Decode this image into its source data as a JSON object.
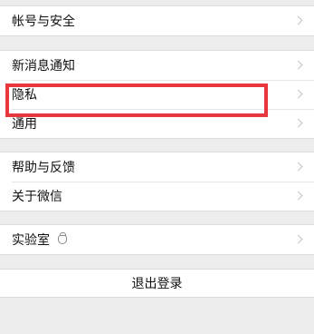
{
  "groups": {
    "account": {
      "items": [
        {
          "label": "帐号与安全"
        }
      ]
    },
    "settings": {
      "items": [
        {
          "label": "新消息通知"
        },
        {
          "label": "隐私"
        },
        {
          "label": "通用"
        }
      ]
    },
    "help": {
      "items": [
        {
          "label": "帮助与反馈"
        },
        {
          "label": "关于微信"
        }
      ]
    },
    "lab": {
      "items": [
        {
          "label": "实验室",
          "icon": "lab-flask-icon"
        }
      ]
    }
  },
  "logout": {
    "label": "退出登录"
  },
  "annotation": {
    "highlight_color": "#e8383d"
  }
}
